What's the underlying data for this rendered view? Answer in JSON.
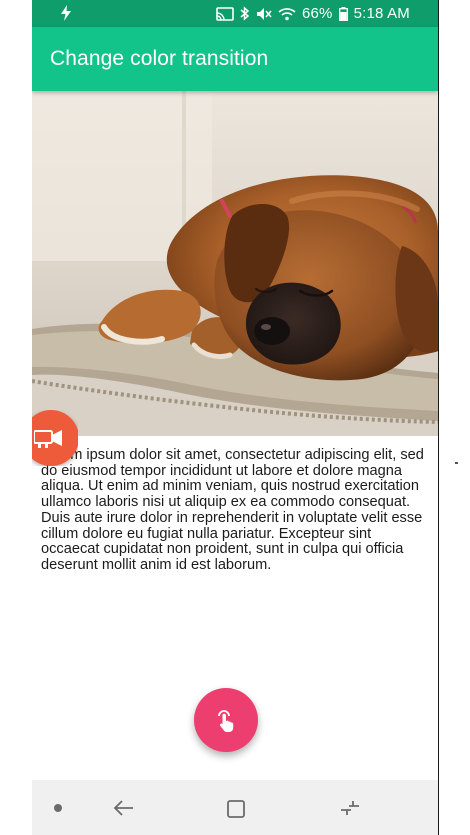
{
  "status_bar": {
    "battery_percent": "66%",
    "time": "5:18 AM",
    "icons": [
      "flash-icon",
      "cast-icon",
      "bluetooth-icon",
      "mute-icon",
      "wifi-icon",
      "battery-icon"
    ]
  },
  "app_bar": {
    "title": "Change color transition"
  },
  "hero": {
    "image_subject": "sleeping-puppy-image"
  },
  "content": {
    "body": "Lorem ipsum dolor sit amet, consectetur adipiscing elit, sed do eiusmod tempor incididunt ut labore et dolore magna aliqua. Ut enim ad minim veniam, quis nostrud exercitation ullamco laboris nisi ut aliquip ex ea commodo consequat. Duis aute irure dolor in reprehenderit in voluptate velit esse cillum dolore eu fugiat nulla pariatur. Excepteur sint occaecat cupidatat non proident, sunt in culpa qui officia deserunt mollit anim id est laborum."
  },
  "buttons": {
    "mini_fab_icon": "video-camera-icon",
    "mini_fab_color": "#ee5b3b",
    "main_fab_icon": "touch-hand-icon",
    "main_fab_color": "#ec3f6f"
  },
  "colors": {
    "status_bar": "#0f9d6c",
    "app_bar": "#12c48a",
    "nav_bar": "#f0f0f0"
  },
  "nav_bar": {
    "icons": [
      "nav-dot-icon",
      "back-icon",
      "home-icon",
      "recents-icon"
    ]
  }
}
